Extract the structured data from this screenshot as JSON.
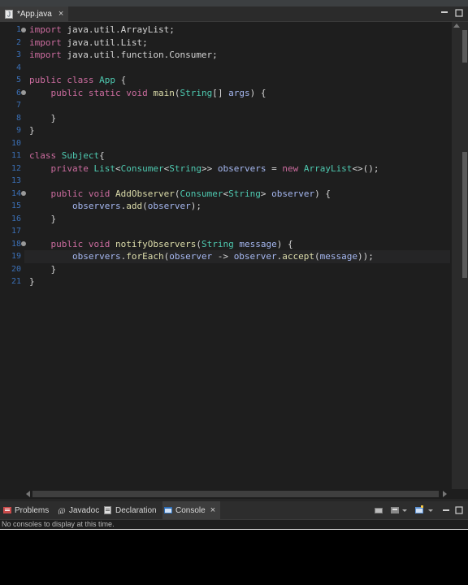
{
  "editor_tab": {
    "title": "*App.java",
    "close": "×"
  },
  "code": {
    "line_numbers": [
      "1",
      "2",
      "3",
      "4",
      "5",
      "6",
      "7",
      "8",
      "9",
      "10",
      "11",
      "12",
      "13",
      "14",
      "15",
      "16",
      "17",
      "18",
      "19",
      "20",
      "21"
    ],
    "lines": [
      [
        [
          "k",
          "import"
        ],
        [
          "p",
          " java.util.ArrayList;"
        ]
      ],
      [
        [
          "k",
          "import"
        ],
        [
          "p",
          " java.util.List;"
        ]
      ],
      [
        [
          "k",
          "import"
        ],
        [
          "p",
          " java.util.function.Consumer;"
        ]
      ],
      [],
      [
        [
          "k",
          "public"
        ],
        [
          "p",
          " "
        ],
        [
          "k",
          "class"
        ],
        [
          "p",
          " "
        ],
        [
          "t",
          "App"
        ],
        [
          "p",
          " {"
        ]
      ],
      [
        [
          "p",
          "    "
        ],
        [
          "k",
          "public"
        ],
        [
          "p",
          " "
        ],
        [
          "k",
          "static"
        ],
        [
          "p",
          " "
        ],
        [
          "k",
          "void"
        ],
        [
          "p",
          " "
        ],
        [
          "f",
          "main"
        ],
        [
          "p",
          "("
        ],
        [
          "t",
          "String"
        ],
        [
          "p",
          "[] "
        ],
        [
          "v",
          "args"
        ],
        [
          "p",
          ") {"
        ]
      ],
      [],
      [
        [
          "p",
          "    }"
        ]
      ],
      [
        [
          "p",
          "}"
        ]
      ],
      [],
      [
        [
          "k",
          "class"
        ],
        [
          "p",
          " "
        ],
        [
          "t",
          "Subject"
        ],
        [
          "p",
          "{"
        ]
      ],
      [
        [
          "p",
          "    "
        ],
        [
          "k",
          "private"
        ],
        [
          "p",
          " "
        ],
        [
          "t",
          "List"
        ],
        [
          "p",
          "<"
        ],
        [
          "t",
          "Consumer"
        ],
        [
          "p",
          "<"
        ],
        [
          "t",
          "String"
        ],
        [
          "p",
          ">> "
        ],
        [
          "v",
          "observers"
        ],
        [
          "p",
          " = "
        ],
        [
          "k",
          "new"
        ],
        [
          "p",
          " "
        ],
        [
          "t",
          "ArrayList"
        ],
        [
          "p",
          "<>();"
        ]
      ],
      [],
      [
        [
          "p",
          "    "
        ],
        [
          "k",
          "public"
        ],
        [
          "p",
          " "
        ],
        [
          "k",
          "void"
        ],
        [
          "p",
          " "
        ],
        [
          "f",
          "AddObserver"
        ],
        [
          "p",
          "("
        ],
        [
          "t",
          "Consumer"
        ],
        [
          "p",
          "<"
        ],
        [
          "t",
          "String"
        ],
        [
          "p",
          "> "
        ],
        [
          "v",
          "observer"
        ],
        [
          "p",
          ") {"
        ]
      ],
      [
        [
          "p",
          "        "
        ],
        [
          "v",
          "observers"
        ],
        [
          "p",
          "."
        ],
        [
          "f",
          "add"
        ],
        [
          "p",
          "("
        ],
        [
          "v",
          "observer"
        ],
        [
          "p",
          ");"
        ]
      ],
      [
        [
          "p",
          "    }"
        ]
      ],
      [],
      [
        [
          "p",
          "    "
        ],
        [
          "k",
          "public"
        ],
        [
          "p",
          " "
        ],
        [
          "k",
          "void"
        ],
        [
          "p",
          " "
        ],
        [
          "f",
          "notifyObservers"
        ],
        [
          "p",
          "("
        ],
        [
          "t",
          "String"
        ],
        [
          "p",
          " "
        ],
        [
          "v",
          "message"
        ],
        [
          "p",
          ") {"
        ]
      ],
      [
        [
          "p",
          "        "
        ],
        [
          "v",
          "observers"
        ],
        [
          "p",
          "."
        ],
        [
          "f",
          "forEach"
        ],
        [
          "p",
          "("
        ],
        [
          "v",
          "observer"
        ],
        [
          "p",
          " -> "
        ],
        [
          "v",
          "observer"
        ],
        [
          "p",
          "."
        ],
        [
          "f",
          "accept"
        ],
        [
          "p",
          "("
        ],
        [
          "v",
          "message"
        ],
        [
          "p",
          "));"
        ]
      ],
      [
        [
          "p",
          "    }"
        ]
      ],
      [
        [
          "p",
          "}"
        ]
      ]
    ]
  },
  "panel": {
    "tabs": [
      {
        "label": "Problems",
        "icon": "problems-icon",
        "active": false
      },
      {
        "label": "Javadoc",
        "icon": "javadoc-icon",
        "active": false
      },
      {
        "label": "Declaration",
        "icon": "declaration-icon",
        "active": false
      },
      {
        "label": "Console",
        "icon": "console-icon",
        "active": true
      }
    ],
    "console_close": "×",
    "console_message": "No consoles to display at this time."
  },
  "colors": {
    "keyword": "#cc6c9f",
    "type": "#4ec9b0",
    "method": "#dcdcaa",
    "variable": "#a5b7f0",
    "line_number": "#3b6fb5"
  }
}
